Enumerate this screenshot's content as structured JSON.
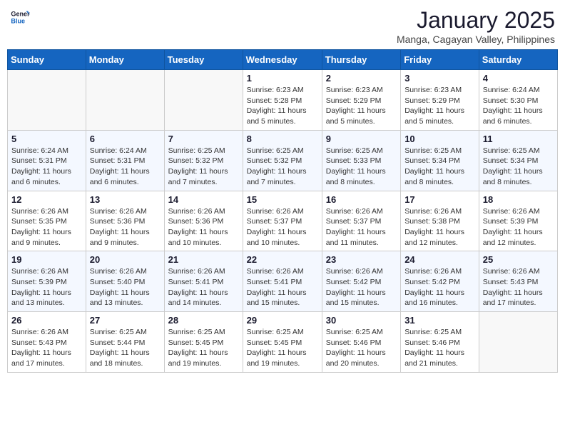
{
  "logo": {
    "line1": "General",
    "line2": "Blue"
  },
  "title": "January 2025",
  "location": "Manga, Cagayan Valley, Philippines",
  "weekdays": [
    "Sunday",
    "Monday",
    "Tuesday",
    "Wednesday",
    "Thursday",
    "Friday",
    "Saturday"
  ],
  "weeks": [
    [
      {
        "day": "",
        "info": ""
      },
      {
        "day": "",
        "info": ""
      },
      {
        "day": "",
        "info": ""
      },
      {
        "day": "1",
        "info": "Sunrise: 6:23 AM\nSunset: 5:28 PM\nDaylight: 11 hours and 5 minutes."
      },
      {
        "day": "2",
        "info": "Sunrise: 6:23 AM\nSunset: 5:29 PM\nDaylight: 11 hours and 5 minutes."
      },
      {
        "day": "3",
        "info": "Sunrise: 6:23 AM\nSunset: 5:29 PM\nDaylight: 11 hours and 5 minutes."
      },
      {
        "day": "4",
        "info": "Sunrise: 6:24 AM\nSunset: 5:30 PM\nDaylight: 11 hours and 6 minutes."
      }
    ],
    [
      {
        "day": "5",
        "info": "Sunrise: 6:24 AM\nSunset: 5:31 PM\nDaylight: 11 hours and 6 minutes."
      },
      {
        "day": "6",
        "info": "Sunrise: 6:24 AM\nSunset: 5:31 PM\nDaylight: 11 hours and 6 minutes."
      },
      {
        "day": "7",
        "info": "Sunrise: 6:25 AM\nSunset: 5:32 PM\nDaylight: 11 hours and 7 minutes."
      },
      {
        "day": "8",
        "info": "Sunrise: 6:25 AM\nSunset: 5:32 PM\nDaylight: 11 hours and 7 minutes."
      },
      {
        "day": "9",
        "info": "Sunrise: 6:25 AM\nSunset: 5:33 PM\nDaylight: 11 hours and 8 minutes."
      },
      {
        "day": "10",
        "info": "Sunrise: 6:25 AM\nSunset: 5:34 PM\nDaylight: 11 hours and 8 minutes."
      },
      {
        "day": "11",
        "info": "Sunrise: 6:25 AM\nSunset: 5:34 PM\nDaylight: 11 hours and 8 minutes."
      }
    ],
    [
      {
        "day": "12",
        "info": "Sunrise: 6:26 AM\nSunset: 5:35 PM\nDaylight: 11 hours and 9 minutes."
      },
      {
        "day": "13",
        "info": "Sunrise: 6:26 AM\nSunset: 5:36 PM\nDaylight: 11 hours and 9 minutes."
      },
      {
        "day": "14",
        "info": "Sunrise: 6:26 AM\nSunset: 5:36 PM\nDaylight: 11 hours and 10 minutes."
      },
      {
        "day": "15",
        "info": "Sunrise: 6:26 AM\nSunset: 5:37 PM\nDaylight: 11 hours and 10 minutes."
      },
      {
        "day": "16",
        "info": "Sunrise: 6:26 AM\nSunset: 5:37 PM\nDaylight: 11 hours and 11 minutes."
      },
      {
        "day": "17",
        "info": "Sunrise: 6:26 AM\nSunset: 5:38 PM\nDaylight: 11 hours and 12 minutes."
      },
      {
        "day": "18",
        "info": "Sunrise: 6:26 AM\nSunset: 5:39 PM\nDaylight: 11 hours and 12 minutes."
      }
    ],
    [
      {
        "day": "19",
        "info": "Sunrise: 6:26 AM\nSunset: 5:39 PM\nDaylight: 11 hours and 13 minutes."
      },
      {
        "day": "20",
        "info": "Sunrise: 6:26 AM\nSunset: 5:40 PM\nDaylight: 11 hours and 13 minutes."
      },
      {
        "day": "21",
        "info": "Sunrise: 6:26 AM\nSunset: 5:41 PM\nDaylight: 11 hours and 14 minutes."
      },
      {
        "day": "22",
        "info": "Sunrise: 6:26 AM\nSunset: 5:41 PM\nDaylight: 11 hours and 15 minutes."
      },
      {
        "day": "23",
        "info": "Sunrise: 6:26 AM\nSunset: 5:42 PM\nDaylight: 11 hours and 15 minutes."
      },
      {
        "day": "24",
        "info": "Sunrise: 6:26 AM\nSunset: 5:42 PM\nDaylight: 11 hours and 16 minutes."
      },
      {
        "day": "25",
        "info": "Sunrise: 6:26 AM\nSunset: 5:43 PM\nDaylight: 11 hours and 17 minutes."
      }
    ],
    [
      {
        "day": "26",
        "info": "Sunrise: 6:26 AM\nSunset: 5:43 PM\nDaylight: 11 hours and 17 minutes."
      },
      {
        "day": "27",
        "info": "Sunrise: 6:25 AM\nSunset: 5:44 PM\nDaylight: 11 hours and 18 minutes."
      },
      {
        "day": "28",
        "info": "Sunrise: 6:25 AM\nSunset: 5:45 PM\nDaylight: 11 hours and 19 minutes."
      },
      {
        "day": "29",
        "info": "Sunrise: 6:25 AM\nSunset: 5:45 PM\nDaylight: 11 hours and 19 minutes."
      },
      {
        "day": "30",
        "info": "Sunrise: 6:25 AM\nSunset: 5:46 PM\nDaylight: 11 hours and 20 minutes."
      },
      {
        "day": "31",
        "info": "Sunrise: 6:25 AM\nSunset: 5:46 PM\nDaylight: 11 hours and 21 minutes."
      },
      {
        "day": "",
        "info": ""
      }
    ]
  ]
}
